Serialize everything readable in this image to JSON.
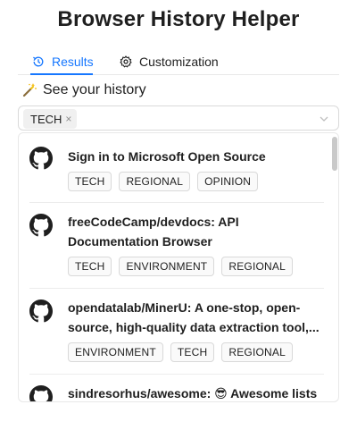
{
  "app": {
    "title": "Browser History Helper"
  },
  "tabs": [
    {
      "label": "Results",
      "icon": "history-icon",
      "active": true
    },
    {
      "label": "Customization",
      "icon": "gear-icon",
      "active": false
    }
  ],
  "section": {
    "heading": "See your history",
    "icon": "magic-wand-icon"
  },
  "filter": {
    "selected": [
      "TECH"
    ],
    "remove_symbol": "×"
  },
  "colors": {
    "accent": "#1677ff",
    "text": "#1f1f1f",
    "border": "#d9d9d9",
    "tag_bg": "#fafafa"
  },
  "results": [
    {
      "icon": "github-icon",
      "title": "Sign in to Microsoft Open Source",
      "tags": [
        "TECH",
        "REGIONAL",
        "OPINION"
      ]
    },
    {
      "icon": "github-icon",
      "title": "freeCodeCamp/devdocs: API Documentation Browser",
      "tags": [
        "TECH",
        "ENVIRONMENT",
        "REGIONAL"
      ]
    },
    {
      "icon": "github-icon",
      "title": "opendatalab/MinerU: A one-stop, open-source, high-quality data extraction tool,...",
      "tags": [
        "ENVIRONMENT",
        "TECH",
        "REGIONAL"
      ]
    },
    {
      "icon": "github-icon",
      "title": "sindresorhus/awesome: 😎 Awesome lists",
      "tags": []
    }
  ]
}
